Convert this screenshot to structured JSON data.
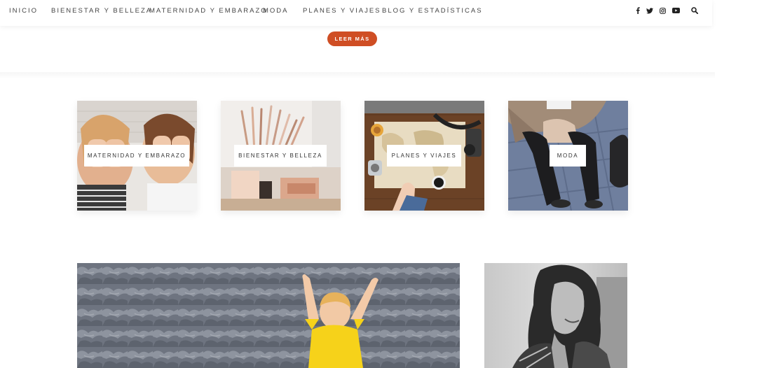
{
  "nav": {
    "items": [
      "INICIO",
      "BIENESTAR Y BELLEZA",
      "MATERNIDAD Y EMBARAZO",
      "MODA",
      "PLANES Y VIAJES",
      "BLOG Y ESTADÍSTICAS"
    ],
    "social_icons": [
      "facebook-icon",
      "twitter-icon",
      "instagram-icon",
      "youtube-icon"
    ],
    "search_icon": "search-icon"
  },
  "post": {
    "read_more_label": "LEER MÁS"
  },
  "categories": [
    {
      "label": "MATERNIDAD Y EMBARAZO"
    },
    {
      "label": "BIENESTAR Y BELLEZA"
    },
    {
      "label": "PLANES Y VIAJES"
    },
    {
      "label": "MODA"
    }
  ],
  "colors": {
    "accent": "#cf4e24",
    "text": "#333333",
    "background": "#ffffff"
  }
}
